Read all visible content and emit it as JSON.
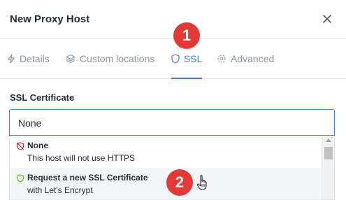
{
  "modal": {
    "title": "New Proxy Host",
    "close_icon": "close-icon"
  },
  "tabs": [
    {
      "label": "Details",
      "icon": "bolt-icon",
      "active": false
    },
    {
      "label": "Custom locations",
      "icon": "layers-icon",
      "active": false
    },
    {
      "label": "SSL",
      "icon": "shield-icon",
      "active": true
    },
    {
      "label": "Advanced",
      "icon": "gear-icon",
      "active": false
    }
  ],
  "ssl": {
    "field_label": "SSL Certificate",
    "selected_value": "None",
    "options": [
      {
        "title": "None",
        "subtitle": "This host will not use HTTPS",
        "icon": "shield-off-icon",
        "icon_color": "#cd201f"
      },
      {
        "title": "Request a new SSL Certificate",
        "subtitle": "with Let's Encrypt",
        "icon": "shield-icon",
        "icon_color": "#5eba00"
      }
    ]
  },
  "annotations": [
    {
      "label": "1"
    },
    {
      "label": "2"
    }
  ],
  "colors": {
    "accent": "#467fcf",
    "badge": "#e53935",
    "muted_tab": "#8a96a3"
  }
}
